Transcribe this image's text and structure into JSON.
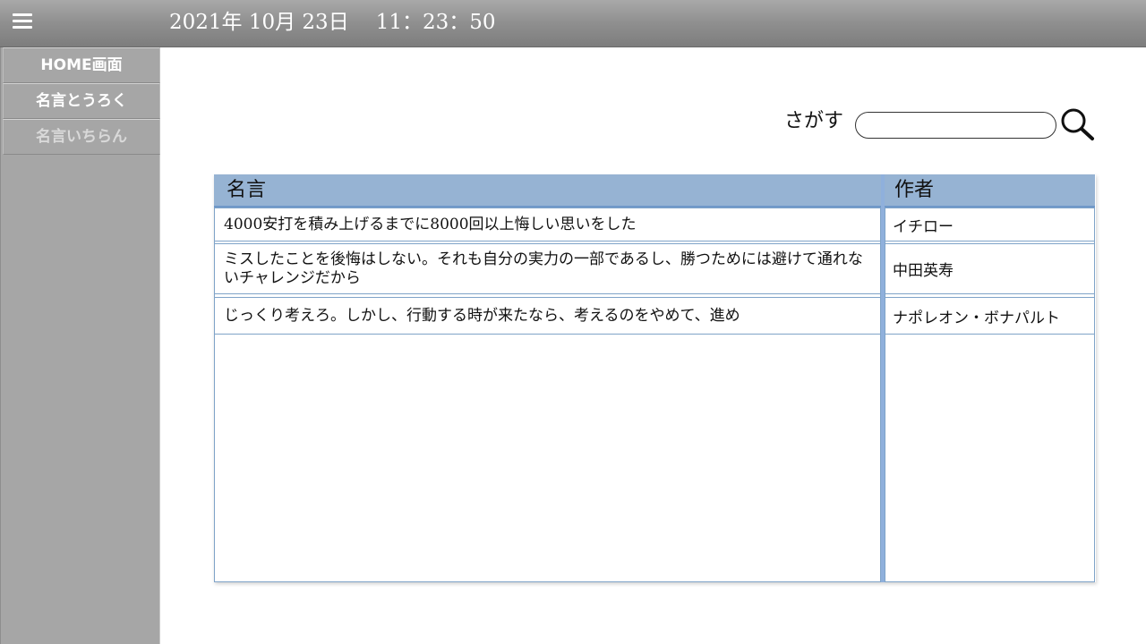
{
  "header": {
    "date": "2021年 10月 23日",
    "time": "11：23：50"
  },
  "sidebar": {
    "items": [
      {
        "label": "HOME画面"
      },
      {
        "label": "名言とうろく"
      },
      {
        "label": "名言いちらん"
      }
    ]
  },
  "search": {
    "label": "さがす",
    "value": "",
    "placeholder": ""
  },
  "table": {
    "headers": {
      "quote": "名言",
      "author": "作者"
    },
    "rows": [
      {
        "quote": "4000安打を積み上げるまでに8000回以上悔しい思いをした",
        "author": "イチロー"
      },
      {
        "quote": "ミスしたことを後悔はしない。それも自分の実力の一部であるし、勝つためには避けて通れないチャレンジだから",
        "author": "中田英寿"
      },
      {
        "quote": "じっくり考えろ。しかし、行動する時が来たなら、考えるのをやめて、進め",
        "author": "ナポレオン・ボナパルト"
      }
    ]
  },
  "icons": {
    "menu": "hamburger-menu-icon",
    "search": "magnifier-icon"
  },
  "colors": {
    "header": "#8f8f8f",
    "sidebar": "#a6a6a6",
    "table_header": "#96b3d3",
    "table_border": "#7fa3c8"
  }
}
